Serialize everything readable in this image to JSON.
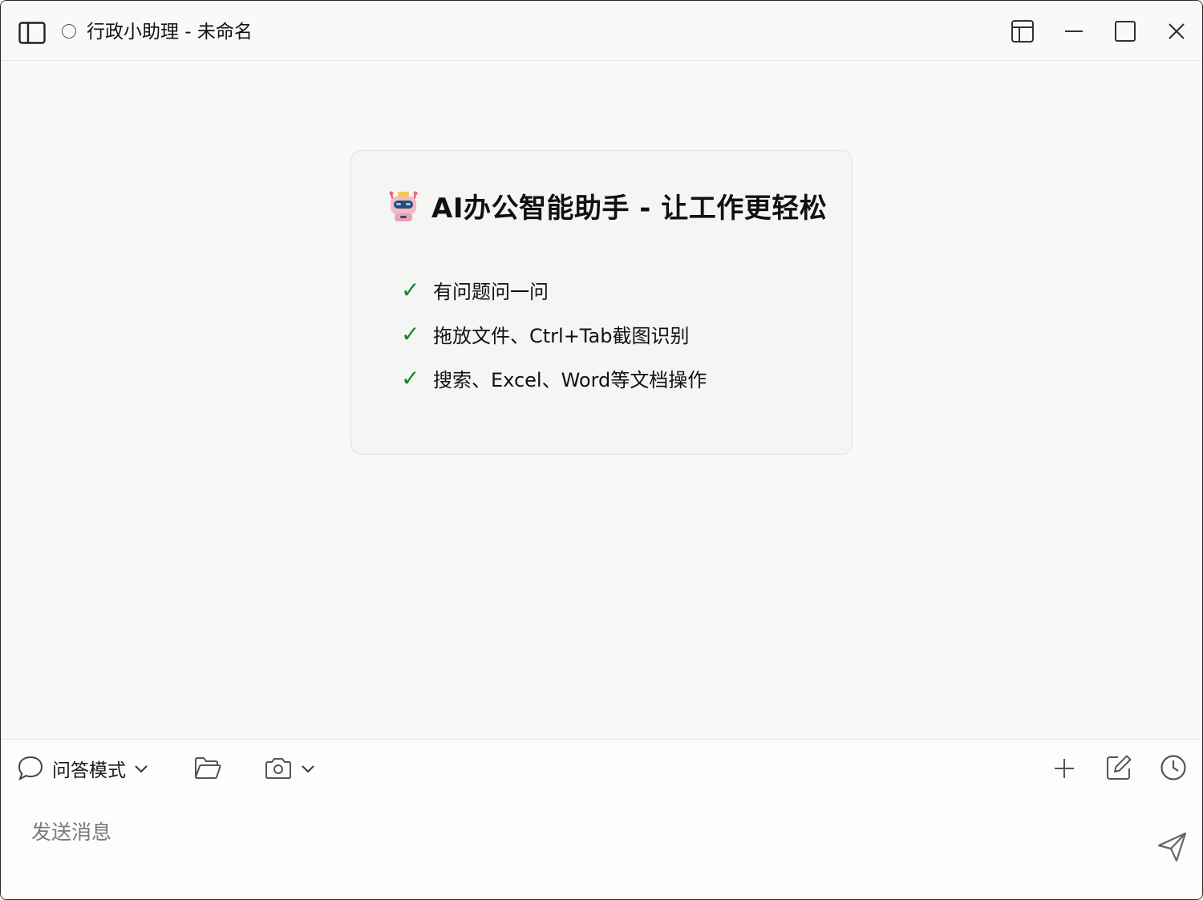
{
  "window": {
    "title": "行政小助理 - 未命名"
  },
  "titlebar": {
    "icons": [
      "sidebar-toggle-icon",
      "status-circle-icon",
      "layout-icon",
      "minimize-icon",
      "maximize-icon",
      "close-icon"
    ]
  },
  "welcome": {
    "title": "AI办公智能助手 - 让工作更轻松",
    "check_glyph": "✓",
    "features": [
      {
        "text": "有问题问一问"
      },
      {
        "text": "拖放文件、Ctrl+Tab截图识别"
      },
      {
        "text": "搜索、Excel、Word等文档操作"
      }
    ]
  },
  "composer": {
    "mode_label": "问答模式",
    "input_placeholder": "发送消息",
    "icons": [
      "chat-bubble-icon",
      "chevron-down-icon",
      "folder-open-icon",
      "camera-icon",
      "plus-icon",
      "edit-icon",
      "history-clock-icon",
      "send-icon"
    ]
  },
  "colors": {
    "background": "#f9f9f7",
    "card_background": "#f5f5f3",
    "check_green": "#0b8a2b",
    "placeholder_gray": "#7a7a7a"
  }
}
